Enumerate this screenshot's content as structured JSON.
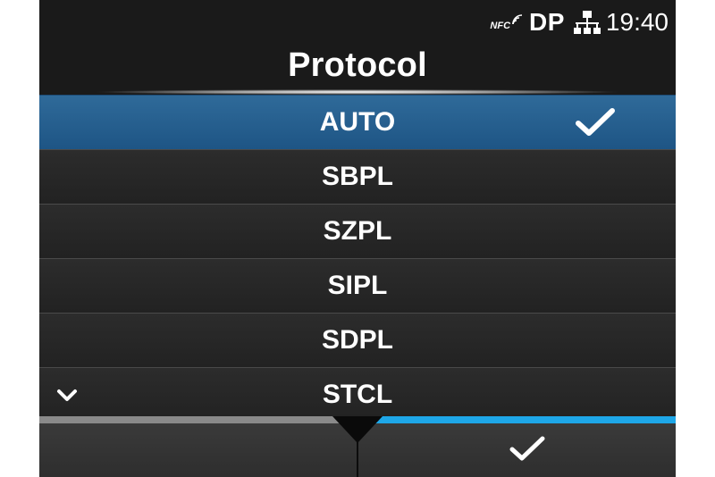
{
  "status_bar": {
    "nfc_label": "NFC",
    "mode": "DP",
    "time": "19:40"
  },
  "title": "Protocol",
  "options": [
    {
      "label": "AUTO",
      "selected": true
    },
    {
      "label": "SBPL",
      "selected": false
    },
    {
      "label": "SZPL",
      "selected": false
    },
    {
      "label": "SIPL",
      "selected": false
    },
    {
      "label": "SDPL",
      "selected": false
    },
    {
      "label": "STCL",
      "selected": false
    }
  ],
  "icons": {
    "selected_marker": "checkmark-icon",
    "more_below": "chevron-down-icon",
    "network": "network-icon",
    "nfc": "nfc-icon",
    "confirm_key": "checkmark-icon"
  },
  "colors": {
    "selected_row": "#2a6394",
    "confirm_bar": "#1ea7e8",
    "cancel_bar": "#8a8a8a"
  }
}
